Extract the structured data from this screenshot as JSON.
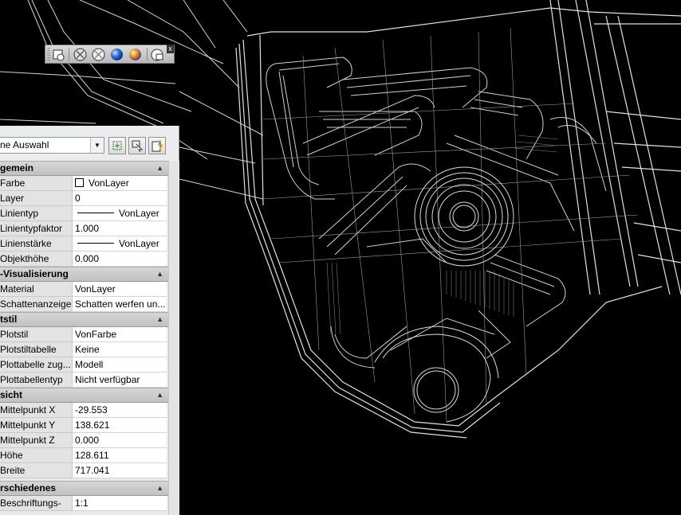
{
  "toolbar": {
    "buttons": [
      {
        "icon": "view-ucs-icon"
      },
      {
        "icon": "hidden-visual-style-icon"
      },
      {
        "icon": "wireframe-visual-style-icon"
      },
      {
        "icon": "shaded-blue-sphere-icon"
      },
      {
        "icon": "realistic-sphere-icon"
      },
      {
        "icon": "visual-style-manager-icon"
      }
    ],
    "close_label": "x"
  },
  "palette": {
    "selection_value": "ne Auswahl",
    "sections": [
      {
        "title": "gemein",
        "rows": [
          {
            "key": "Farbe",
            "value": "VonLayer",
            "kind": "color"
          },
          {
            "key": "Layer",
            "value": "0"
          },
          {
            "key": "Linientyp",
            "value": "VonLayer",
            "kind": "linetype"
          },
          {
            "key": "Linientypfaktor",
            "value": "1.000"
          },
          {
            "key": "Linienstärke",
            "value": "VonLayer",
            "kind": "linetype"
          },
          {
            "key": "Objekthöhe",
            "value": "0.000"
          }
        ]
      },
      {
        "title": "-Visualisierung",
        "rows": [
          {
            "key": "Material",
            "value": "VonLayer"
          },
          {
            "key": "Schattenanzeige",
            "value": "Schatten werfen un..."
          }
        ]
      },
      {
        "title": "tstil",
        "rows": [
          {
            "key": "Plotstil",
            "value": "VonFarbe"
          },
          {
            "key": "Plotstiltabelle",
            "value": "Keine"
          },
          {
            "key": "Plottabelle zug...",
            "value": "Modell"
          },
          {
            "key": "Plottabellentyp",
            "value": "Nicht verfügbar"
          }
        ]
      },
      {
        "title": "sicht",
        "rows": [
          {
            "key": "Mittelpunkt X",
            "value": "-29.553"
          },
          {
            "key": "Mittelpunkt Y",
            "value": "138.621"
          },
          {
            "key": "Mittelpunkt Z",
            "value": "0.000"
          },
          {
            "key": "Höhe",
            "value": "128.611"
          },
          {
            "key": "Breite",
            "value": "717.041"
          }
        ]
      },
      {
        "title": "rschiedenes",
        "rows": [
          {
            "key": "Beschriftungs-",
            "value": "1:1"
          }
        ]
      }
    ]
  },
  "colors": {
    "background": "#000000",
    "wire": "#d8d8d8",
    "palette": "#e9e9e9"
  }
}
